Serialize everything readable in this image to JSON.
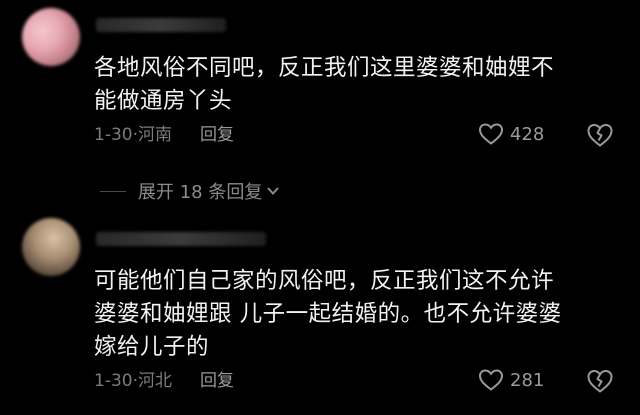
{
  "comments": [
    {
      "text": "各地风俗不同吧，反正我们这里婆婆和妯娌不\n能做通房丫头",
      "date": "1-30",
      "location": "河南",
      "reply_label": "回复",
      "likes": "428"
    },
    {
      "text": "可能他们自己家的风俗吧，反正我们这不允许\n婆婆和妯娌跟 儿子一起结婚的。也不允许婆婆\n嫁给儿子的",
      "date": "1-30",
      "location": "河北",
      "reply_label": "回复",
      "likes": "281"
    }
  ],
  "expand_replies_label": "展开 18 条回复",
  "meta_separator": "·",
  "icons": {
    "like": "heart-outline-icon",
    "dislike": "broken-heart-icon",
    "expand": "chevron-down-icon"
  },
  "colors": {
    "background": "#000000",
    "text": "#f2f2f2",
    "meta": "#7d7d7d"
  }
}
